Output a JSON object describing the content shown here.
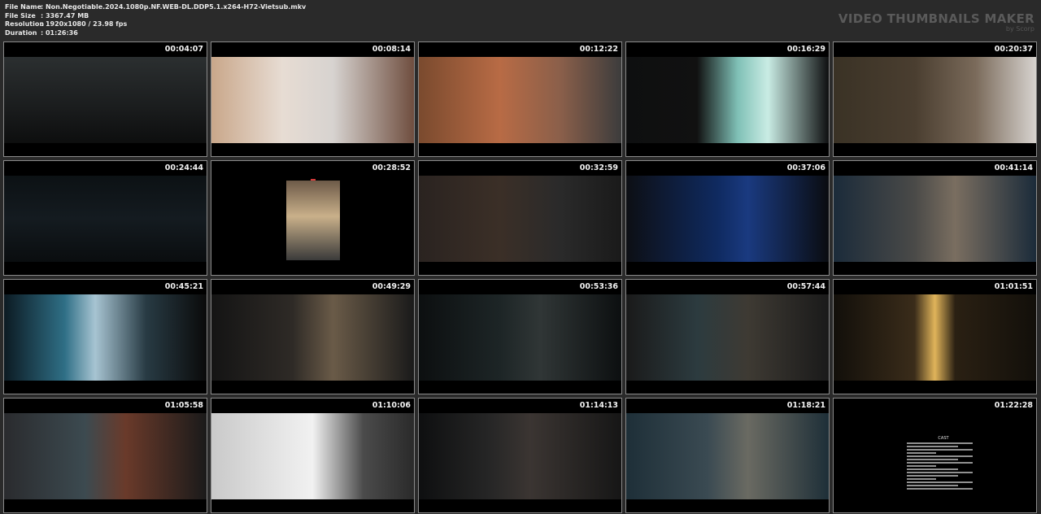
{
  "info": {
    "rows": [
      {
        "key": "File Name",
        "value": ": Non.Negotiable.2024.1080p.NF.WEB-DL.DDP5.1.x264-H72-Vietsub.mkv"
      },
      {
        "key": "File Size",
        "value": ": 3367.47 MB"
      },
      {
        "key": "Resolution",
        "value": ": 1920x1080 / 23.98 fps"
      },
      {
        "key": "Duration",
        "value": ": 01:26:36"
      }
    ]
  },
  "brand": {
    "title": "VIDEO THUMBNAILS MAKER",
    "subtitle": "by Scorp"
  },
  "thumbnails": [
    {
      "time": "00:04:07"
    },
    {
      "time": "00:08:14"
    },
    {
      "time": "00:12:22"
    },
    {
      "time": "00:16:29"
    },
    {
      "time": "00:20:37"
    },
    {
      "time": "00:24:44"
    },
    {
      "time": "00:28:52"
    },
    {
      "time": "00:32:59"
    },
    {
      "time": "00:37:06"
    },
    {
      "time": "00:41:14"
    },
    {
      "time": "00:45:21"
    },
    {
      "time": "00:49:29"
    },
    {
      "time": "00:53:36"
    },
    {
      "time": "00:57:44"
    },
    {
      "time": "01:01:51"
    },
    {
      "time": "01:05:58"
    },
    {
      "time": "01:10:06"
    },
    {
      "time": "01:14:13"
    },
    {
      "time": "01:18:21"
    },
    {
      "time": "01:22:28"
    }
  ],
  "credits_title": "CAST"
}
